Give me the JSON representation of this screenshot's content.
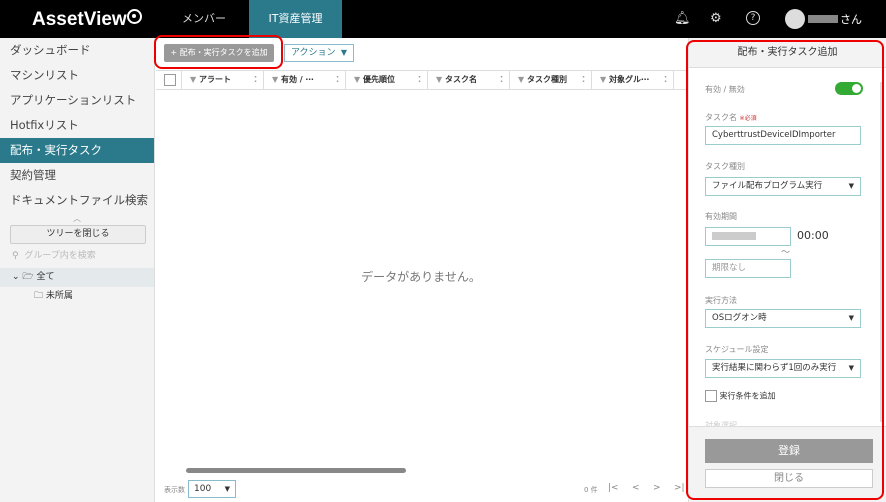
{
  "header": {
    "logo": "AssetView",
    "tabs": [
      "メンバー",
      "IT資産管理"
    ],
    "user_suffix": "さん",
    "icons": [
      "bell-icon",
      "gear-icon",
      "help-icon"
    ]
  },
  "sidebar": {
    "items": [
      "ダッシュボード",
      "マシンリスト",
      "アプリケーションリスト",
      "Hotfixリスト",
      "配布・実行タスク",
      "契約管理",
      "ドキュメントファイル検索"
    ],
    "active_index": 4,
    "tree_button": "ツリーを閉じる",
    "group_search_placeholder": "グループ内を検索",
    "tree": [
      "全て",
      "未所属"
    ]
  },
  "main": {
    "add_button": "+ 配布・実行タスクを追加",
    "action_button": "アクション",
    "columns": [
      "アラート",
      "有効 / ⋯",
      "優先順位",
      "タスク名",
      "タスク種別",
      "対象グル⋯"
    ],
    "empty_message": "データがありません。",
    "footer": {
      "page_size_label": "表示数",
      "page_size": "100",
      "count": "0 件"
    }
  },
  "panel": {
    "title": "配布・実行タスク追加",
    "enabled_label": "有効 / 無効",
    "enabled": true,
    "task_name_label": "タスク名",
    "required": "※必須",
    "task_name": "CyberttrustDeviceIDImporter",
    "task_type_label": "タスク種別",
    "task_type": "ファイル配布プログラム実行",
    "period_label": "有効期間",
    "start_time": "00:00",
    "tilde": "〜",
    "end_placeholder": "期限なし",
    "method_label": "実行方法",
    "method": "OSログオン時",
    "schedule_label": "スケジュール設定",
    "schedule": "実行結果に関わらず1回のみ実行",
    "condition_label": "実行条件を追加",
    "target_label": "対象選択",
    "register": "登録",
    "close": "閉じる"
  }
}
